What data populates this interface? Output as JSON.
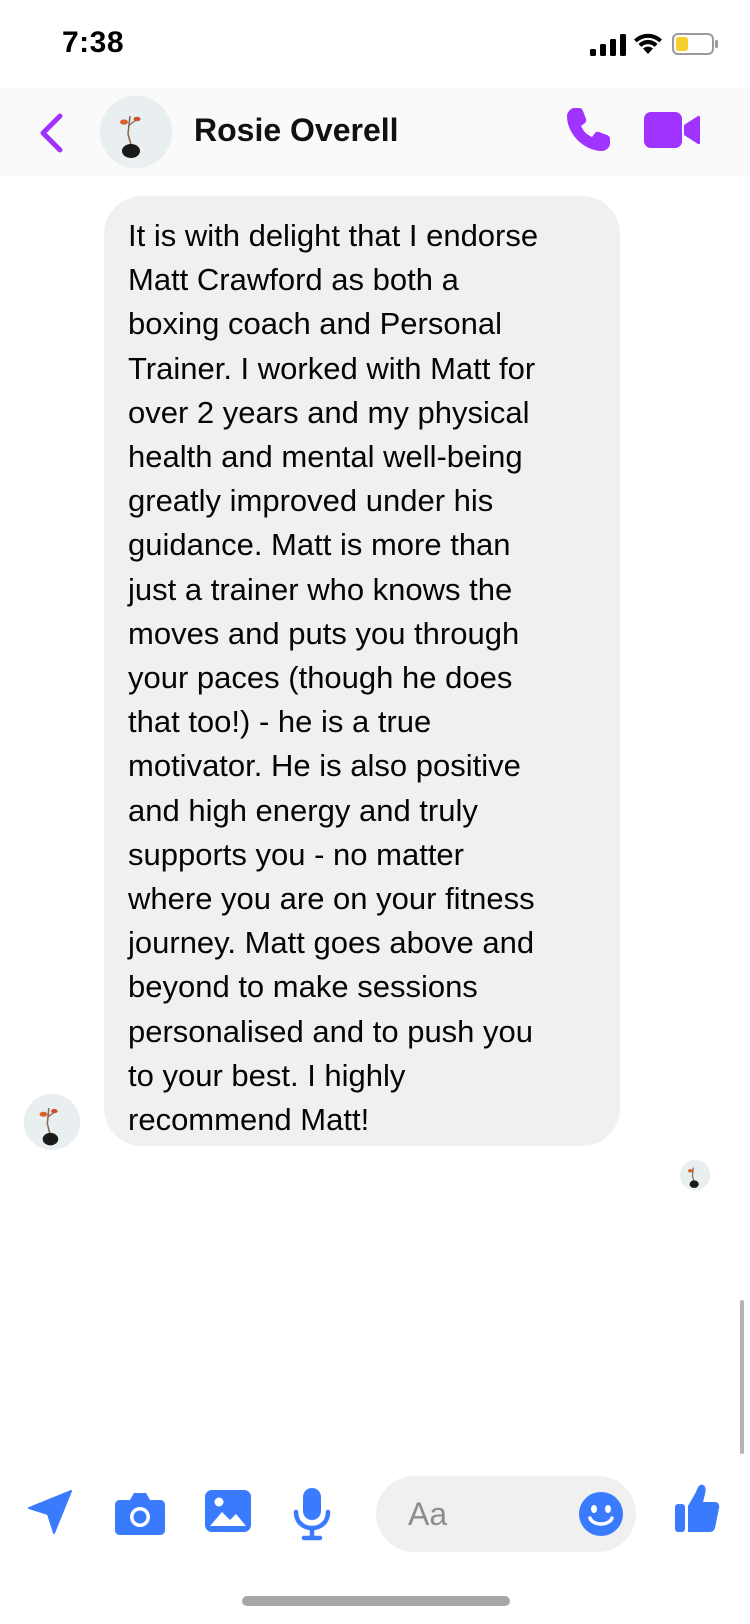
{
  "status_bar": {
    "time": "7:38"
  },
  "header": {
    "contact_name": "Rosie Overell"
  },
  "message": {
    "lines": [
      "It is with delight that I endorse",
      "Matt Crawford as both a",
      "boxing coach and Personal",
      "Trainer. I worked with Matt for",
      "over 2 years and my physical",
      "health and mental well-being",
      "greatly improved under his",
      "guidance. Matt is more than",
      "just a trainer who knows the",
      "moves and puts you through",
      "your paces (though he does",
      "that too!) - he is a true",
      "motivator. He is also positive",
      "and high energy and truly",
      "supports you - no matter",
      "where you are on your fitness",
      "journey. Matt goes above and",
      "beyond to make sessions",
      "personalised and to push you",
      "to your best. I highly",
      "recommend Matt!"
    ]
  },
  "composer": {
    "placeholder": "Aa"
  },
  "colors": {
    "accent_purple": "#a033ff",
    "accent_blue": "#3a7bfd",
    "bubble_bg": "#f0f0f0"
  },
  "icons": {
    "back": "chevron-left-icon",
    "call": "phone-icon",
    "video": "video-camera-icon",
    "send_location": "paper-plane-icon",
    "camera": "camera-icon",
    "gallery": "image-icon",
    "mic": "microphone-icon",
    "emoji": "smiley-icon",
    "like": "thumbs-up-icon"
  }
}
